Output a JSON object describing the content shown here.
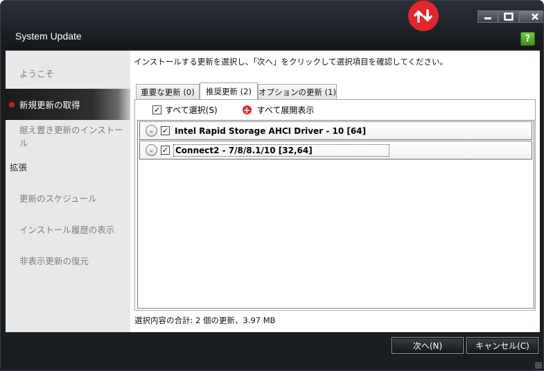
{
  "window": {
    "title": "System Update"
  },
  "sidebar": {
    "items": [
      {
        "label": "ようこそ"
      },
      {
        "label": "新規更新の取得"
      },
      {
        "label": "据え置き更新のインストール"
      }
    ],
    "section": "拡張",
    "extra_items": [
      {
        "label": "更新のスケジュール"
      },
      {
        "label": "インストール履歴の表示"
      },
      {
        "label": "非表示更新の復元"
      }
    ]
  },
  "main": {
    "instruction": "インストールする更新を選択し、「次へ」をクリックして選択項目を確認してください。",
    "tabs": [
      {
        "label": "重要な更新 (0)"
      },
      {
        "label": "推奨更新 (2)"
      },
      {
        "label": "オプションの更新 (1)"
      }
    ],
    "toolbar": {
      "select_all": "すべて選択(S)",
      "expand_all": "すべて展開表示"
    },
    "updates": [
      {
        "label": "Intel Rapid Storage AHCI Driver - 10 [64]",
        "checked": true
      },
      {
        "label": "Connect2 - 7/8/8.1/10 [32,64]",
        "checked": true
      }
    ],
    "summary": "選択内容の合計: 2 個の更新、3.97 MB"
  },
  "footer": {
    "next": "次へ(N)",
    "cancel": "キャンセル(C)"
  },
  "colors": {
    "accent": "#e4262b",
    "help": "#5fb32f"
  },
  "icons": [
    "app-logo-icon",
    "minimize-icon",
    "maximize-icon",
    "close-icon",
    "help-icon",
    "checkbox-icon",
    "plus-icon",
    "chevron-down-icon"
  ]
}
